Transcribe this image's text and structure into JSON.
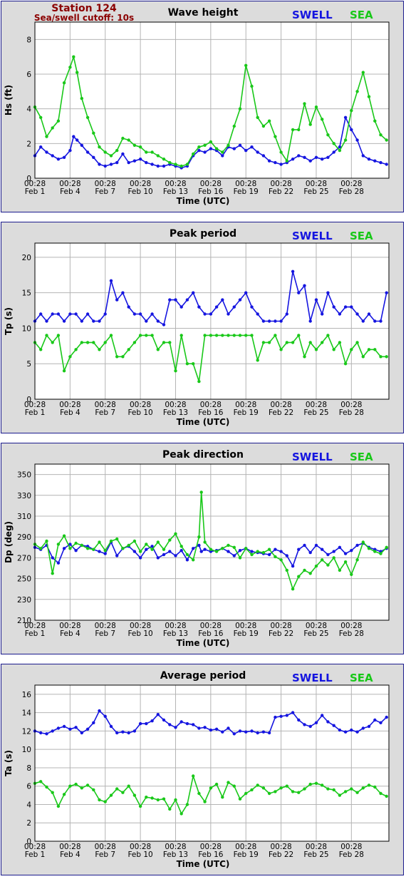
{
  "header": {
    "station": "Station 124",
    "cutoff": "Sea/swell cutoff: 10s"
  },
  "colors": {
    "swell": "#1515e0",
    "sea": "#19c819",
    "grid": "#b4b4b4"
  },
  "chart_data": [
    {
      "type": "line",
      "title": "Wave height",
      "ylabel": "Hs (ft)",
      "xlabel": "Time (UTC)",
      "ylim": [
        0,
        9
      ],
      "yticks": [
        0,
        2,
        4,
        6,
        8
      ],
      "xticks": [
        {
          "time": "00:28",
          "date": "Feb 1"
        },
        {
          "time": "00:28",
          "date": "Feb 4"
        },
        {
          "time": "00:28",
          "date": "Feb 7"
        },
        {
          "time": "00:28",
          "date": "Feb 10"
        },
        {
          "time": "00:28",
          "date": "Feb 13"
        },
        {
          "time": "00:28",
          "date": "Feb 16"
        },
        {
          "time": "00:28",
          "date": "Feb 19"
        },
        {
          "time": "00:28",
          "date": "Feb 22"
        },
        {
          "time": "00:28",
          "date": "Feb 25"
        },
        {
          "time": "00:28",
          "date": "Feb 28"
        }
      ],
      "x_days": [
        0,
        0.5,
        1,
        1.5,
        2,
        2.5,
        3,
        3.3,
        3.6,
        4,
        4.5,
        5,
        5.5,
        6,
        6.5,
        7,
        7.5,
        8,
        8.5,
        9,
        9.5,
        10,
        10.5,
        11,
        11.5,
        12,
        12.5,
        13,
        13.5,
        14,
        14.5,
        15,
        15.5,
        16,
        16.5,
        17,
        17.5,
        18,
        18.5,
        19,
        19.5,
        20,
        20.5,
        21,
        21.5,
        22,
        22.5,
        23,
        23.5,
        24,
        24.5,
        25,
        25.5,
        26,
        26.5,
        27,
        27.5,
        28,
        28.5,
        29,
        29.5,
        30
      ],
      "series": [
        {
          "name": "SWELL",
          "values": [
            1.3,
            1.8,
            1.5,
            1.3,
            1.1,
            1.2,
            1.6,
            2.4,
            2.2,
            1.9,
            1.5,
            1.2,
            0.8,
            0.7,
            0.8,
            0.9,
            1.4,
            0.9,
            1.0,
            1.1,
            0.9,
            0.8,
            0.7,
            0.7,
            0.8,
            0.7,
            0.6,
            0.7,
            1.3,
            1.6,
            1.5,
            1.7,
            1.6,
            1.3,
            1.8,
            1.7,
            1.9,
            1.6,
            1.8,
            1.5,
            1.3,
            1.0,
            0.9,
            0.8,
            0.9,
            1.1,
            1.3,
            1.2,
            1.0,
            1.2,
            1.1,
            1.2,
            1.5,
            1.8,
            3.5,
            2.8,
            2.2,
            1.3,
            1.1,
            1.0,
            0.9,
            0.8
          ]
        },
        {
          "name": "SEA",
          "values": [
            4.1,
            3.5,
            2.4,
            2.9,
            3.3,
            5.5,
            6.4,
            7.0,
            6.1,
            4.6,
            3.5,
            2.6,
            1.8,
            1.5,
            1.3,
            1.6,
            2.3,
            2.2,
            1.9,
            1.8,
            1.5,
            1.5,
            1.3,
            1.1,
            0.9,
            0.8,
            0.7,
            0.8,
            1.4,
            1.8,
            1.9,
            2.1,
            1.7,
            1.5,
            1.9,
            3.0,
            4.0,
            6.5,
            5.3,
            3.5,
            3.0,
            3.3,
            2.4,
            1.5,
            1.0,
            2.8,
            2.8,
            4.3,
            3.1,
            4.1,
            3.4,
            2.5,
            2.0,
            1.6,
            2.2,
            3.9,
            5.0,
            6.1,
            4.7,
            3.3,
            2.5,
            2.2
          ]
        }
      ]
    },
    {
      "type": "line",
      "title": "Peak period",
      "ylabel": "Tp (s)",
      "xlabel": "Time (UTC)",
      "ylim": [
        0,
        22
      ],
      "yticks": [
        0,
        5,
        10,
        15,
        20
      ],
      "xticks": [
        {
          "time": "00:28",
          "date": "Feb 1"
        },
        {
          "time": "00:28",
          "date": "Feb 4"
        },
        {
          "time": "00:28",
          "date": "Feb 7"
        },
        {
          "time": "00:28",
          "date": "Feb 10"
        },
        {
          "time": "00:28",
          "date": "Feb 13"
        },
        {
          "time": "00:28",
          "date": "Feb 16"
        },
        {
          "time": "00:28",
          "date": "Feb 19"
        },
        {
          "time": "00:28",
          "date": "Feb 22"
        },
        {
          "time": "00:28",
          "date": "Feb 25"
        },
        {
          "time": "00:28",
          "date": "Feb 28"
        }
      ],
      "x_days": [
        0,
        0.5,
        1,
        1.5,
        2,
        2.5,
        3,
        3.5,
        4,
        4.5,
        5,
        5.5,
        6,
        6.5,
        7,
        7.5,
        8,
        8.5,
        9,
        9.5,
        10,
        10.5,
        11,
        11.5,
        12,
        12.5,
        13,
        13.5,
        14,
        14.5,
        15,
        15.5,
        16,
        16.5,
        17,
        17.5,
        18,
        18.5,
        19,
        19.5,
        20,
        20.5,
        21,
        21.5,
        22,
        22.5,
        23,
        23.5,
        24,
        24.5,
        25,
        25.5,
        26,
        26.5,
        27,
        27.5,
        28,
        28.5,
        29,
        29.5,
        30
      ],
      "series": [
        {
          "name": "SWELL",
          "values": [
            11,
            12,
            11,
            12,
            12,
            11,
            12,
            12,
            11,
            12,
            11,
            11,
            12,
            16.7,
            14,
            15,
            13,
            12,
            12,
            11,
            12,
            11,
            10.5,
            14,
            14,
            13,
            14,
            15,
            13,
            12,
            12,
            13,
            14,
            12,
            13,
            14,
            15,
            13,
            12,
            11,
            11,
            11,
            11,
            12,
            18,
            15,
            16,
            11,
            14,
            12,
            15,
            13,
            12,
            13,
            13,
            12,
            11,
            12,
            11,
            11,
            15
          ]
        },
        {
          "name": "SEA",
          "values": [
            8,
            7,
            9,
            8,
            9,
            4,
            6,
            7,
            8,
            8,
            8,
            7,
            8,
            9,
            6,
            6,
            7,
            8,
            9,
            9,
            9,
            7,
            8,
            8,
            4,
            9,
            5,
            5,
            2.5,
            9,
            9,
            9,
            9,
            9,
            9,
            9,
            9,
            9,
            5.5,
            8,
            8,
            9,
            7,
            8,
            8,
            9,
            6,
            8,
            7,
            8,
            9,
            7,
            8,
            5,
            7,
            8,
            6,
            7,
            7,
            6,
            6
          ]
        }
      ]
    },
    {
      "type": "line",
      "title": "Peak direction",
      "ylabel": "Dp (deg)",
      "xlabel": "Time (UTC)",
      "ylim": [
        210,
        360
      ],
      "yticks": [
        210,
        230,
        250,
        270,
        290,
        310,
        330,
        350
      ],
      "xticks": [
        {
          "time": "00:28",
          "date": "Feb 1"
        },
        {
          "time": "00:28",
          "date": "Feb 4"
        },
        {
          "time": "00:28",
          "date": "Feb 7"
        },
        {
          "time": "00:28",
          "date": "Feb 10"
        },
        {
          "time": "00:28",
          "date": "Feb 13"
        },
        {
          "time": "00:28",
          "date": "Feb 16"
        },
        {
          "time": "00:28",
          "date": "Feb 19"
        },
        {
          "time": "00:28",
          "date": "Feb 22"
        },
        {
          "time": "00:28",
          "date": "Feb 25"
        },
        {
          "time": "00:28",
          "date": "Feb 28"
        }
      ],
      "x_days": [
        0,
        0.5,
        1,
        1.5,
        2,
        2.5,
        3,
        3.5,
        4,
        4.5,
        5,
        5.5,
        6,
        6.5,
        7,
        7.5,
        8,
        8.5,
        9,
        9.5,
        10,
        10.5,
        11,
        11.5,
        12,
        12.5,
        13,
        13.5,
        14,
        14.2,
        14.5,
        15,
        15.5,
        16,
        16.5,
        17,
        17.5,
        18,
        18.5,
        19,
        19.5,
        20,
        20.5,
        21,
        21.5,
        22,
        22.5,
        23,
        23.5,
        24,
        24.5,
        25,
        25.5,
        26,
        26.5,
        27,
        27.5,
        28,
        28.5,
        29,
        29.5,
        30
      ],
      "series": [
        {
          "name": "SWELL",
          "values": [
            280,
            278,
            282,
            270,
            265,
            279,
            283,
            277,
            282,
            281,
            278,
            276,
            274,
            285,
            272,
            279,
            281,
            276,
            270,
            278,
            281,
            270,
            273,
            276,
            272,
            277,
            268,
            279,
            282,
            276,
            278,
            276,
            277,
            279,
            276,
            272,
            277,
            279,
            276,
            275,
            274,
            273,
            278,
            276,
            272,
            262,
            278,
            282,
            275,
            282,
            278,
            273,
            276,
            280,
            274,
            277,
            282,
            284,
            280,
            278,
            276,
            279
          ]
        },
        {
          "name": "SEA",
          "values": [
            283,
            279,
            286,
            255,
            283,
            291,
            279,
            284,
            282,
            279,
            278,
            285,
            277,
            286,
            288,
            279,
            282,
            286,
            276,
            283,
            278,
            285,
            278,
            287,
            293,
            281,
            273,
            268,
            290,
            333,
            285,
            278,
            276,
            279,
            282,
            280,
            270,
            279,
            273,
            276,
            275,
            278,
            271,
            268,
            258,
            240,
            252,
            258,
            255,
            262,
            268,
            263,
            270,
            258,
            266,
            254,
            268,
            285,
            279,
            276,
            274,
            280
          ]
        }
      ]
    },
    {
      "type": "line",
      "title": "Average period",
      "ylabel": "Ta (s)",
      "xlabel": "Time (UTC)",
      "ylim": [
        0,
        17
      ],
      "yticks": [
        0,
        2,
        4,
        6,
        8,
        10,
        12,
        14,
        16
      ],
      "xticks": [
        {
          "time": "00:28",
          "date": "Feb 1"
        },
        {
          "time": "00:28",
          "date": "Feb 4"
        },
        {
          "time": "00:28",
          "date": "Feb 7"
        },
        {
          "time": "00:28",
          "date": "Feb 10"
        },
        {
          "time": "00:28",
          "date": "Feb 13"
        },
        {
          "time": "00:28",
          "date": "Feb 16"
        },
        {
          "time": "00:28",
          "date": "Feb 19"
        },
        {
          "time": "00:28",
          "date": "Feb 22"
        },
        {
          "time": "00:28",
          "date": "Feb 25"
        },
        {
          "time": "00:28",
          "date": "Feb 28"
        }
      ],
      "x_days": [
        0,
        0.5,
        1,
        1.5,
        2,
        2.5,
        3,
        3.5,
        4,
        4.5,
        5,
        5.5,
        6,
        6.5,
        7,
        7.5,
        8,
        8.5,
        9,
        9.5,
        10,
        10.5,
        11,
        11.5,
        12,
        12.5,
        13,
        13.5,
        14,
        14.5,
        15,
        15.5,
        16,
        16.5,
        17,
        17.5,
        18,
        18.5,
        19,
        19.5,
        20,
        20.5,
        21,
        21.5,
        22,
        22.5,
        23,
        23.5,
        24,
        24.5,
        25,
        25.5,
        26,
        26.5,
        27,
        27.5,
        28,
        28.5,
        29,
        29.5,
        30
      ],
      "series": [
        {
          "name": "SWELL",
          "values": [
            12.0,
            11.8,
            11.7,
            12.0,
            12.3,
            12.5,
            12.2,
            12.4,
            11.8,
            12.2,
            12.9,
            14.2,
            13.6,
            12.5,
            11.8,
            11.9,
            11.8,
            12.0,
            12.8,
            12.8,
            13.1,
            13.8,
            13.2,
            12.7,
            12.4,
            13.0,
            12.8,
            12.7,
            12.3,
            12.4,
            12.1,
            12.2,
            11.9,
            12.3,
            11.7,
            12.0,
            11.9,
            12.0,
            11.8,
            11.9,
            11.8,
            13.5,
            13.6,
            13.7,
            14.0,
            13.2,
            12.7,
            12.5,
            12.9,
            13.7,
            13.0,
            12.6,
            12.1,
            11.9,
            12.1,
            11.9,
            12.3,
            12.5,
            13.2,
            12.9,
            13.5
          ]
        },
        {
          "name": "SEA",
          "values": [
            6.3,
            6.5,
            5.9,
            5.3,
            3.8,
            5.1,
            6.0,
            6.2,
            5.8,
            6.1,
            5.6,
            4.5,
            4.3,
            5.0,
            5.7,
            5.3,
            6.0,
            5.0,
            3.8,
            4.8,
            4.7,
            4.5,
            4.6,
            3.5,
            4.5,
            3.0,
            4.0,
            7.1,
            5.2,
            4.3,
            5.8,
            6.2,
            4.8,
            6.4,
            6.0,
            4.6,
            5.2,
            5.6,
            6.1,
            5.8,
            5.2,
            5.4,
            5.8,
            6.0,
            5.4,
            5.3,
            5.7,
            6.2,
            6.3,
            6.1,
            5.7,
            5.6,
            5.0,
            5.4,
            5.7,
            5.3,
            5.8,
            6.1,
            5.9,
            5.2,
            4.9
          ]
        }
      ]
    }
  ]
}
